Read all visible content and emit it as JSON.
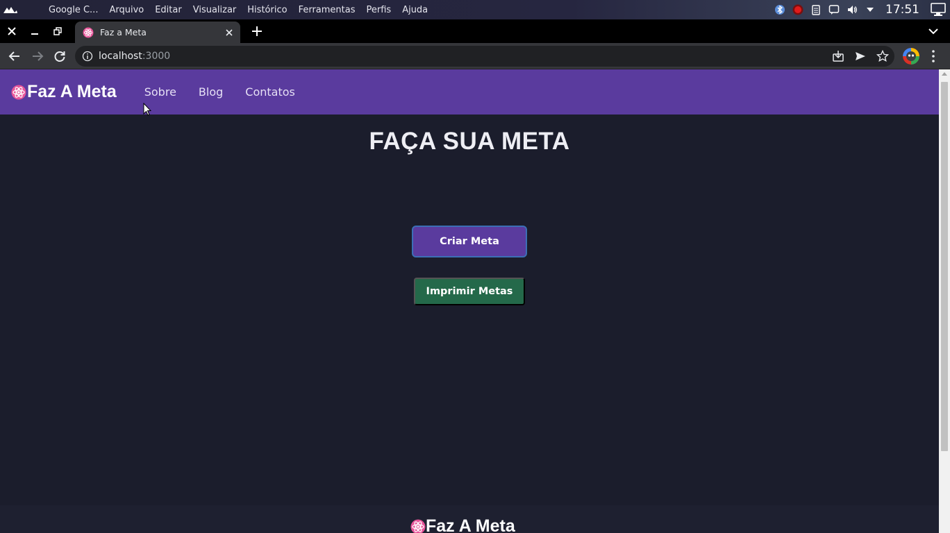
{
  "os": {
    "menu": [
      "Google C...",
      "Arquivo",
      "Editar",
      "Visualizar",
      "Histórico",
      "Ferramentas",
      "Perfis",
      "Ajuda"
    ],
    "clock": "17:51"
  },
  "browser": {
    "tab_title": "Faz a Meta",
    "url_host": "localhost",
    "url_port": ":3000"
  },
  "site": {
    "brand": "Faz A Meta",
    "nav": [
      "Sobre",
      "Blog",
      "Contatos"
    ],
    "title": "FAÇA SUA META",
    "criar_label": "Criar Meta",
    "imprimir_label": "Imprimir Metas",
    "footer_brand": "Faz A Meta"
  },
  "colors": {
    "navbar": "#5a3b9e",
    "background": "#1b1d2c",
    "criar_button": "#5a3b9e",
    "imprimir_button": "#24694a",
    "brand_icon": "#e8559a"
  },
  "icons": [
    "app-launcher-icon",
    "bluetooth-icon",
    "record-icon",
    "clipboard-icon",
    "chat-icon",
    "volume-icon",
    "dropdown-icon",
    "display-icon",
    "close-icon",
    "minimize-icon",
    "restore-icon",
    "react-favicon",
    "plus-icon",
    "tab-search-icon",
    "back-icon",
    "forward-icon",
    "reload-icon",
    "info-icon",
    "install-icon",
    "send-icon",
    "bookmark-star-icon",
    "profile-avatar",
    "kebab-menu-icon"
  ]
}
